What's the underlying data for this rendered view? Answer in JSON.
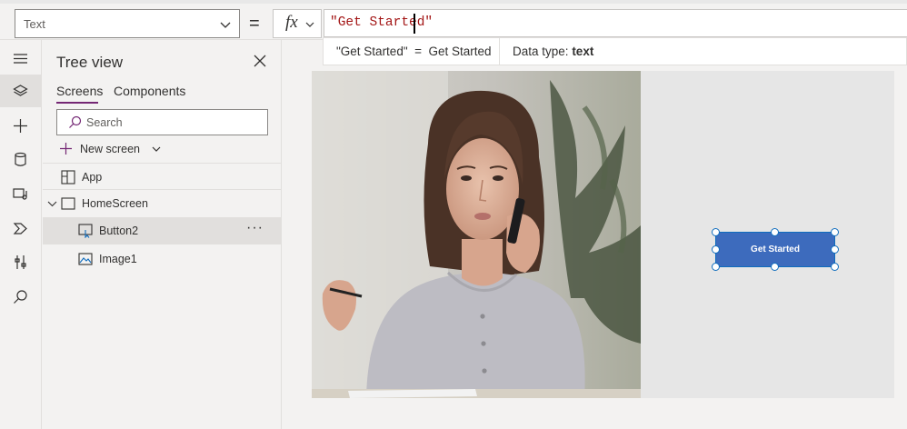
{
  "formula_bar": {
    "property": "Text",
    "equals": "=",
    "fx_label": "fx",
    "formula": "\"Get Started\""
  },
  "hint": {
    "result": "\"Get Started\"  =  Get Started",
    "data_type_label": "Data type:",
    "data_type_value": "text"
  },
  "rail": {
    "items": [
      "hamburger-icon",
      "layers-icon",
      "plus-icon",
      "database-icon",
      "media-icon",
      "power-automate-icon",
      "tools-icon",
      "search-icon"
    ],
    "active": "layers-icon"
  },
  "tree_view": {
    "title": "Tree view",
    "tabs": [
      {
        "label": "Screens",
        "active": true
      },
      {
        "label": "Components",
        "active": false
      }
    ],
    "search_placeholder": "Search",
    "new_screen_label": "New screen",
    "items": [
      {
        "label": "App",
        "icon": "app-grid-icon"
      },
      {
        "label": "HomeScreen",
        "icon": "screen-icon",
        "expanded": true
      },
      {
        "label": "Button2",
        "icon": "button-control-icon",
        "selected": true,
        "more": "···"
      },
      {
        "label": "Image1",
        "icon": "image-control-icon"
      }
    ]
  },
  "canvas": {
    "button_text": "Get Started",
    "button_color": "#3d6bbd",
    "accent": "#742774",
    "selection_color": "#0f6cbd"
  }
}
